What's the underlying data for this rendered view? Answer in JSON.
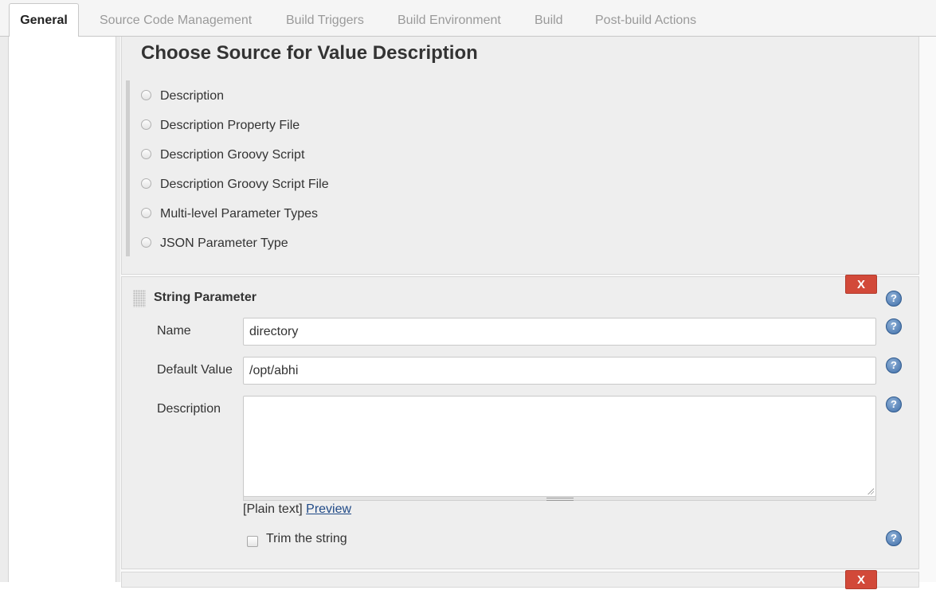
{
  "tabs": [
    "General",
    "Source Code Management",
    "Build Triggers",
    "Build Environment",
    "Build",
    "Post-build Actions"
  ],
  "choose_section": {
    "title": "Choose Source for Value Description",
    "options": [
      "Description",
      "Description Property File",
      "Description Groovy Script",
      "Description Groovy Script File",
      "Multi-level Parameter Types",
      "JSON Parameter Type"
    ]
  },
  "string_parameter": {
    "title": "String Parameter",
    "delete_label": "X",
    "help_glyph": "?",
    "name_label": "Name",
    "name_value": "directory",
    "default_label": "Default Value",
    "default_value": "/opt/abhi",
    "description_label": "Description",
    "description_value": "",
    "format_prefix": "[Plain text]",
    "preview_link": "Preview",
    "trim_label": "Trim the string"
  },
  "next_panel": {
    "delete_label": "X"
  },
  "colors": {
    "delete_button": "#d24939",
    "help_icon": "#3f6ea8",
    "link": "#204a87"
  }
}
